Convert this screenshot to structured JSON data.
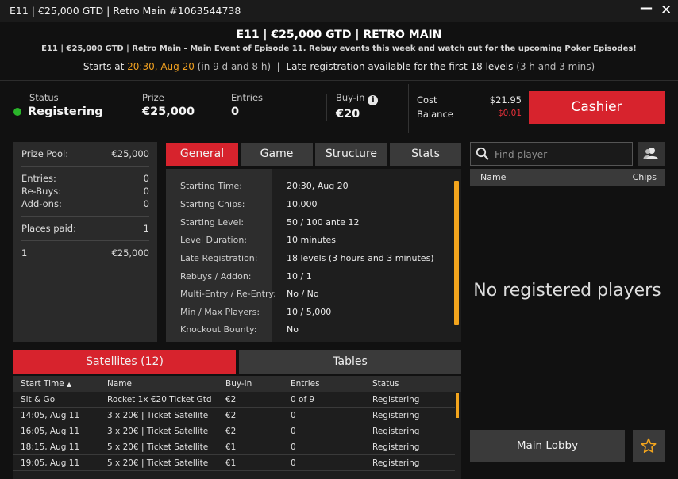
{
  "window": {
    "title": "E11 | €25,000 GTD | Retro Main #1063544738",
    "minimize": "—",
    "close": "✕"
  },
  "header": {
    "title": "E11 | €25,000 GTD |  RETRO MAIN",
    "subtitle": "E11 | €25,000 GTD |  Retro Main -  Main Event of Episode 11. Rebuy events this week and watch out for the upcoming Poker Episodes!",
    "starts_prefix": "Starts at ",
    "starts_time": "20:30, Aug 20",
    "starts_in": " (in 9 d and 8 h)",
    "separator": "  |  ",
    "late_reg": "Late registration available for the first 18 levels ",
    "late_reg_time": "(3 h and 3 mins)"
  },
  "status": {
    "status_label": "Status",
    "status_value": "Registering",
    "status_color": "#2ab52a",
    "prize_label": "Prize",
    "prize_value": "€25,000",
    "entries_label": "Entries",
    "entries_value": "0",
    "buyin_label": "Buy-in",
    "buyin_value": "€20",
    "info_icon": "i",
    "cost_label": "Cost",
    "cost_value": "$21.95",
    "balance_label": "Balance",
    "balance_value": "$0.01",
    "cashier_label": "Cashier"
  },
  "prize_pool": {
    "prize_pool_label": "Prize Pool:",
    "prize_pool_value": "€25,000",
    "entries_label": "Entries:",
    "entries_value": "0",
    "rebuys_label": "Re-Buys:",
    "rebuys_value": "0",
    "addons_label": "Add-ons:",
    "addons_value": "0",
    "places_label": "Places paid:",
    "places_value": "1",
    "payouts": [
      {
        "place": "1",
        "amount": "€25,000"
      }
    ]
  },
  "tabs": [
    {
      "label": "General",
      "active": true
    },
    {
      "label": "Game",
      "active": false
    },
    {
      "label": "Structure",
      "active": false
    },
    {
      "label": "Stats",
      "active": false
    }
  ],
  "general": [
    {
      "key": "Starting Time:",
      "value": "20:30, Aug 20"
    },
    {
      "key": "Starting Chips:",
      "value": "10,000"
    },
    {
      "key": "Starting Level:",
      "value": "50 / 100 ante 12"
    },
    {
      "key": "Level Duration:",
      "value": "10 minutes"
    },
    {
      "key": "Late Registration:",
      "value": "18 levels (3 hours and 3 minutes)"
    },
    {
      "key": "Rebuys / Addon:",
      "value": "10 / 1"
    },
    {
      "key": "Multi-Entry / Re-Entry:",
      "value": "No / No"
    },
    {
      "key": "Min / Max Players:",
      "value": "10 / 5,000"
    },
    {
      "key": "Knockout Bounty:",
      "value": "No"
    }
  ],
  "bottom_tabs": [
    {
      "label": "Satellites (12)",
      "active": true
    },
    {
      "label": "Tables",
      "active": false
    }
  ],
  "satellites": {
    "headers": [
      "Start Time",
      "Name",
      "Buy-in",
      "Entries",
      "Status"
    ],
    "sort_arrow": "▲",
    "rows": [
      [
        "Sit & Go",
        "Rocket 1x €20 Ticket Gtd",
        "€2",
        "0 of 9",
        "Registering"
      ],
      [
        "14:05, Aug 11",
        "3 x 20€ | Ticket Satellite",
        "€2",
        "0",
        "Registering"
      ],
      [
        "16:05, Aug 11",
        "3 x 20€ | Ticket Satellite",
        "€2",
        "0",
        "Registering"
      ],
      [
        "18:15, Aug 11",
        "5 x 20€ | Ticket Satellite",
        "€1",
        "0",
        "Registering"
      ],
      [
        "19:05, Aug 11",
        "5 x 20€ | Ticket Satellite",
        "€1",
        "0",
        "Registering"
      ]
    ]
  },
  "players": {
    "search_placeholder": "Find player",
    "name_header": "Name",
    "chips_header": "Chips",
    "empty_message": "No registered players"
  },
  "footer": {
    "main_lobby": "Main Lobby"
  },
  "colors": {
    "accent_red": "#d7232d",
    "scroll_orange": "#f3a51d",
    "highlight_orange": "#f0a020",
    "negative_red": "#e8303a"
  },
  "icons": {
    "search": "search-icon",
    "user": "user-icon",
    "star": "star-icon",
    "info": "info-icon",
    "close": "close-icon",
    "minimize": "minimize-icon"
  }
}
